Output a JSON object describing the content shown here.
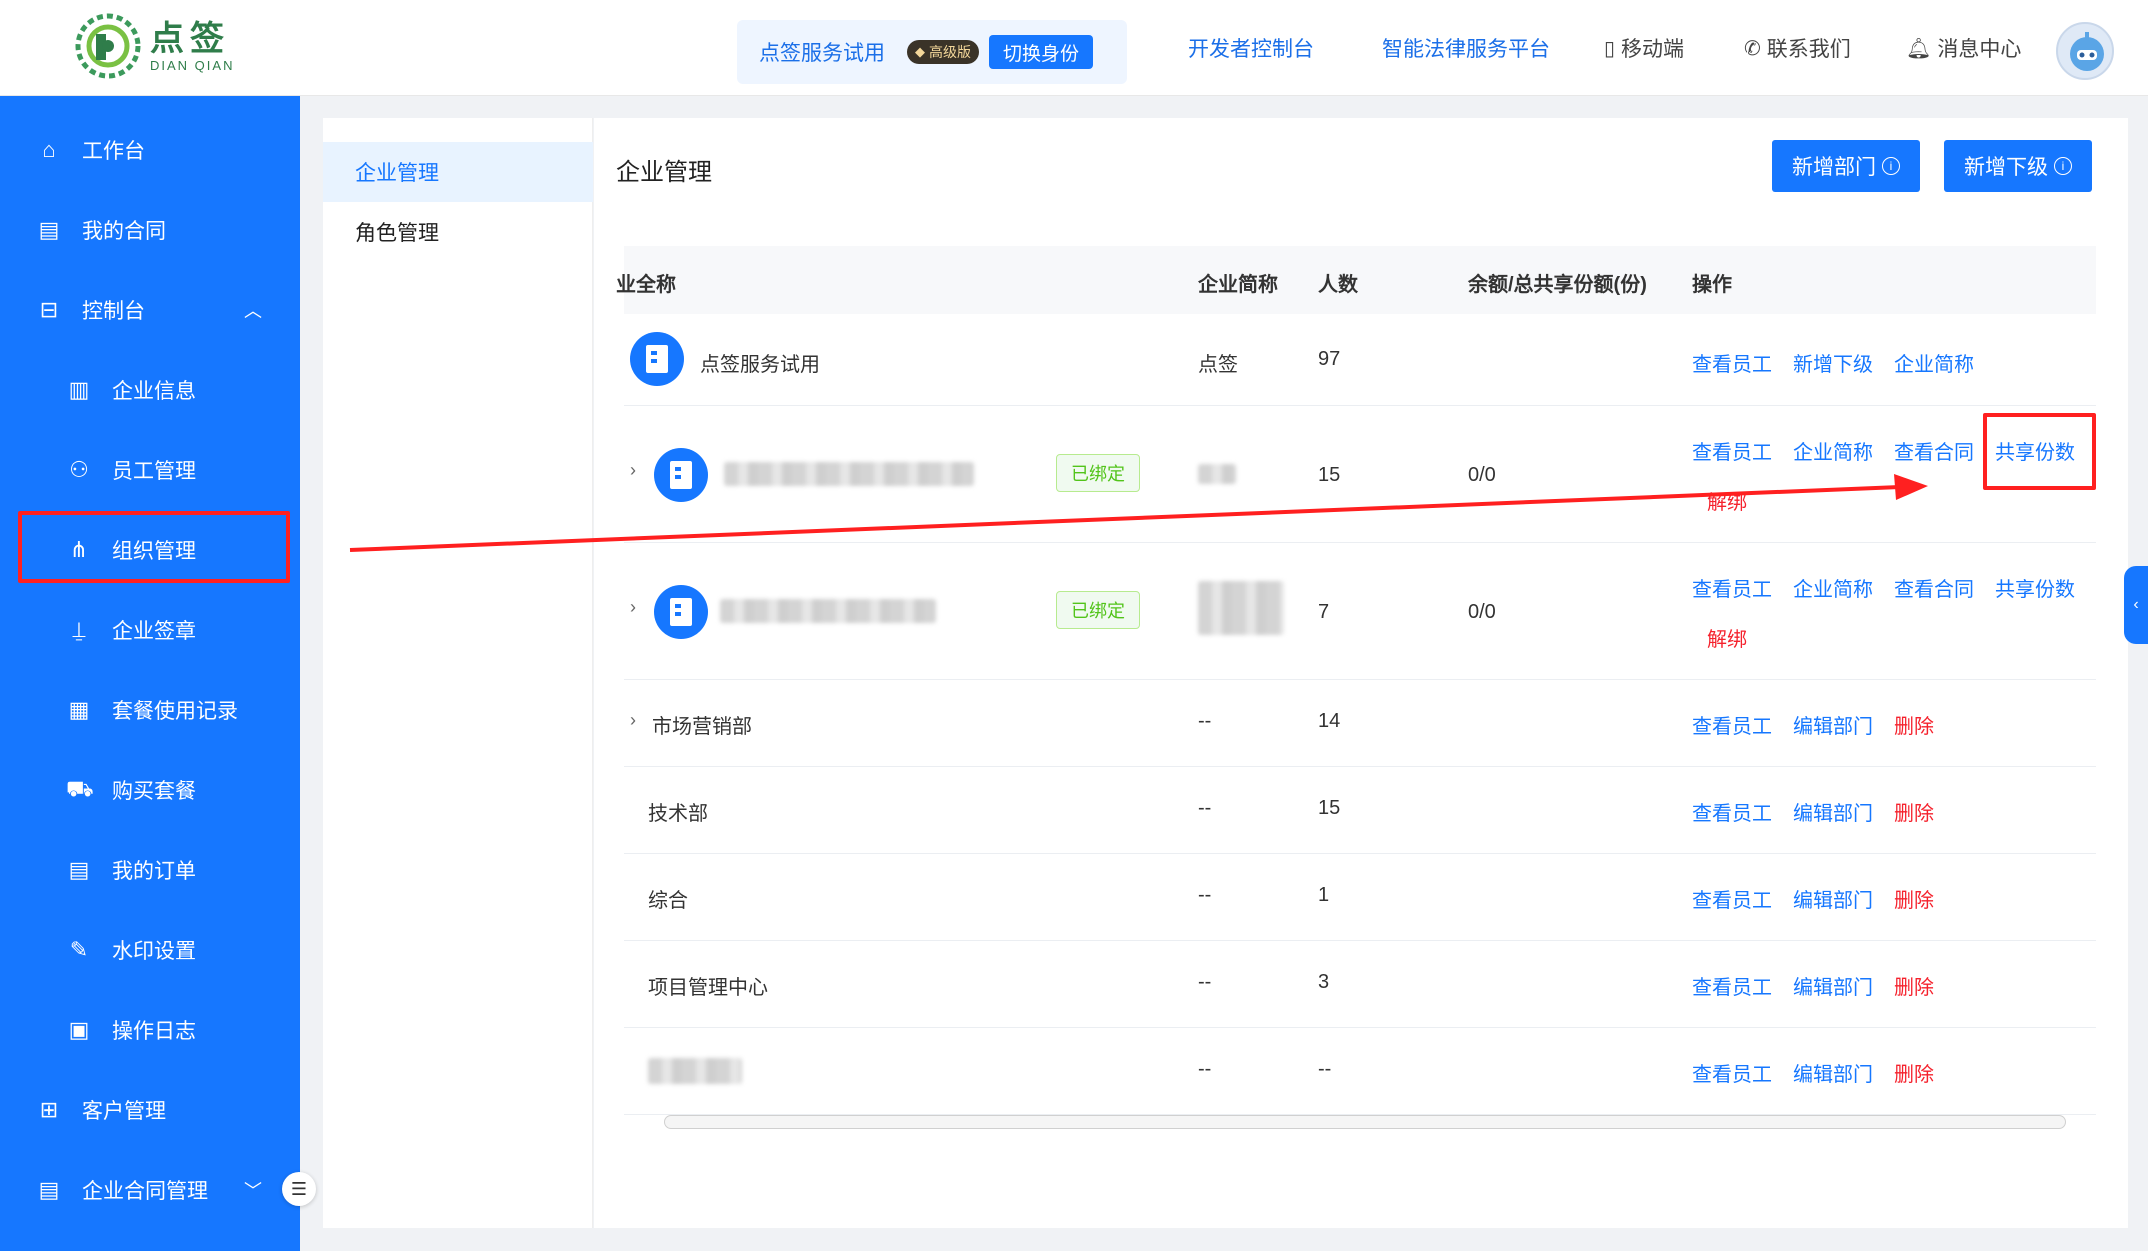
{
  "brand": {
    "name_cn": "点签",
    "name_en": "DIAN QIAN"
  },
  "header": {
    "identity": {
      "name": "点签服务试用",
      "badge": "高级版",
      "switch_label": "切换身份"
    },
    "nav": {
      "developer": "开发者控制台",
      "legal": "智能法律服务平台",
      "mobile": "移动端",
      "contact": "联系我们",
      "messages": "消息中心"
    }
  },
  "sidebar": {
    "items": [
      {
        "label": "工作台",
        "icon": "home-icon"
      },
      {
        "label": "我的合同",
        "icon": "contract-icon"
      },
      {
        "label": "控制台",
        "icon": "console-icon"
      },
      {
        "label": "企业信息",
        "icon": "building-icon"
      },
      {
        "label": "员工管理",
        "icon": "user-icon"
      },
      {
        "label": "组织管理",
        "icon": "org-tree-icon"
      },
      {
        "label": "企业签章",
        "icon": "stamp-icon"
      },
      {
        "label": "套餐使用记录",
        "icon": "record-icon"
      },
      {
        "label": "购买套餐",
        "icon": "cart-icon"
      },
      {
        "label": "我的订单",
        "icon": "order-icon"
      },
      {
        "label": "水印设置",
        "icon": "pen-icon"
      },
      {
        "label": "操作日志",
        "icon": "log-icon"
      },
      {
        "label": "客户管理",
        "icon": "briefcase-icon"
      },
      {
        "label": "企业合同管理",
        "icon": "doc-icon"
      }
    ],
    "active": "组织管理"
  },
  "submenu": {
    "items": [
      "企业管理",
      "角色管理"
    ],
    "active": "企业管理"
  },
  "main": {
    "title": "企业管理",
    "add_dept": "新增部门",
    "add_sub": "新增下级",
    "columns": {
      "fullname": "业全称",
      "short": "企业简称",
      "count": "人数",
      "quota": "余额/总共享份额(份)",
      "ops": "操作"
    },
    "rows": [
      {
        "name": "点签服务试用",
        "short": "点签",
        "count": "97",
        "quota": "",
        "actions": [
          "查看员工",
          "新增下级",
          "企业简称"
        ]
      },
      {
        "name": "",
        "tag": "已绑定",
        "short": "",
        "count": "15",
        "quota": "0/0",
        "actions": [
          "查看员工",
          "企业简称",
          "查看合同",
          "共享份数"
        ],
        "action2": "解绑"
      },
      {
        "name": "",
        "tag": "已绑定",
        "short": "",
        "count": "7",
        "quota": "0/0",
        "actions": [
          "查看员工",
          "企业简称",
          "查看合同",
          "共享份数"
        ],
        "action2": "解绑"
      },
      {
        "name": "市场营销部",
        "short": "--",
        "count": "14",
        "actions": [
          "查看员工",
          "编辑部门"
        ],
        "danger": "删除"
      },
      {
        "name": "技术部",
        "short": "--",
        "count": "15",
        "actions": [
          "查看员工",
          "编辑部门"
        ],
        "danger": "删除"
      },
      {
        "name": "综合",
        "short": "--",
        "count": "1",
        "actions": [
          "查看员工",
          "编辑部门"
        ],
        "danger": "删除"
      },
      {
        "name": "项目管理中心",
        "short": "--",
        "count": "3",
        "actions": [
          "查看员工",
          "编辑部门"
        ],
        "danger": "删除"
      },
      {
        "name": "",
        "short": "--",
        "count": "--",
        "actions": [
          "查看员工",
          "编辑部门"
        ],
        "danger": "删除"
      }
    ]
  },
  "colors": {
    "primary": "#1677ff",
    "danger": "#f5222d",
    "success": "#52c41a",
    "annotation": "#ff2020"
  }
}
